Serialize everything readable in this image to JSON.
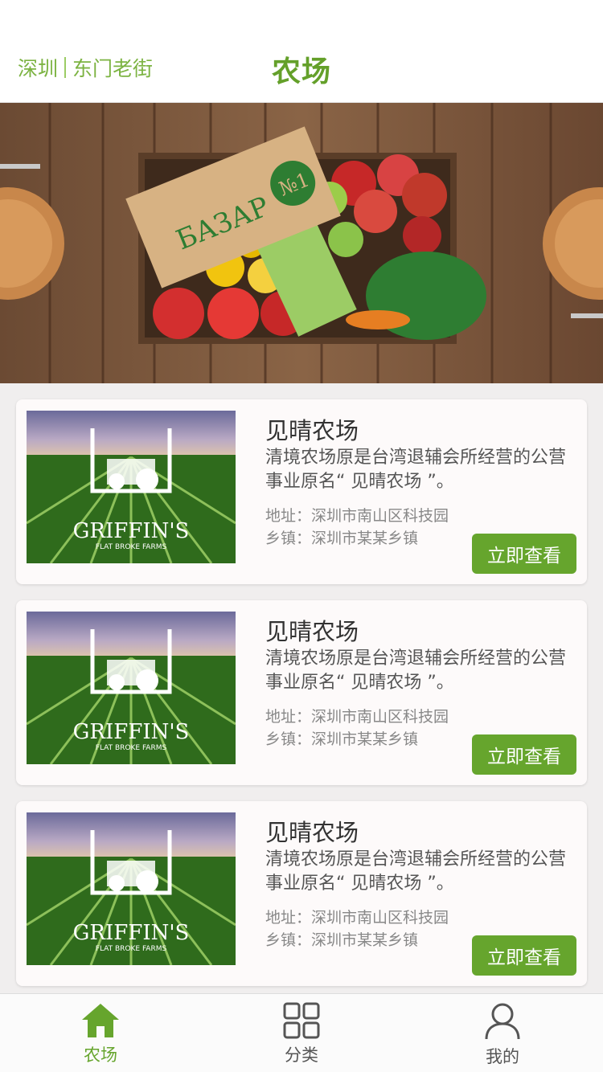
{
  "header": {
    "city": "深圳",
    "district": "东门老街",
    "title": "农场"
  },
  "banner": {
    "alt": "БАЗАР №1"
  },
  "farms": [
    {
      "name": "见晴农场",
      "desc": "清境农场原是台湾退辅会所经营的公营事业原名“ 见晴农场 ”。",
      "address_label": "地址：",
      "address": "深圳市南山区科技园",
      "town_label": "乡镇：",
      "town": "深圳市某某乡镇",
      "button": "立即查看",
      "logo_title": "GRIFFIN'S",
      "logo_sub": "FLAT BROKE FARMS"
    },
    {
      "name": "见晴农场",
      "desc": "清境农场原是台湾退辅会所经营的公营事业原名“ 见晴农场 ”。",
      "address_label": "地址：",
      "address": "深圳市南山区科技园",
      "town_label": "乡镇：",
      "town": "深圳市某某乡镇",
      "button": "立即查看",
      "logo_title": "GRIFFIN'S",
      "logo_sub": "FLAT BROKE FARMS"
    },
    {
      "name": "见晴农场",
      "desc": "清境农场原是台湾退辅会所经营的公营事业原名“ 见晴农场 ”。",
      "address_label": "地址：",
      "address": "深圳市南山区科技园",
      "town_label": "乡镇：",
      "town": "深圳市某某乡镇",
      "button": "立即查看",
      "logo_title": "GRIFFIN'S",
      "logo_sub": "FLAT BROKE FARMS"
    }
  ],
  "tabs": [
    {
      "label": "农场",
      "icon": "home-icon",
      "active": true
    },
    {
      "label": "分类",
      "icon": "grid-icon",
      "active": false
    },
    {
      "label": "我的",
      "icon": "user-icon",
      "active": false
    }
  ],
  "colors": {
    "accent": "#66a52d",
    "accent_light": "#7cb342"
  }
}
